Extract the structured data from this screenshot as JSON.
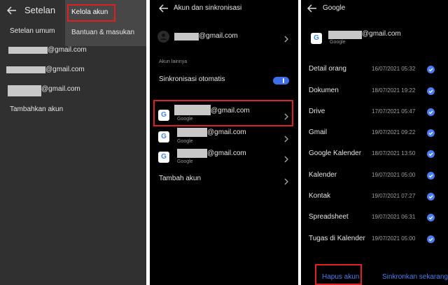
{
  "panel1": {
    "title": "Setelan",
    "menu": [
      "Setelan umum",
      "Tambahkan akun"
    ],
    "accounts": [
      "@gmail.com",
      "@gmail.com",
      "@gmail.com"
    ],
    "popup": {
      "manage": "Kelola akun",
      "help": "Bantuan & masukan"
    }
  },
  "panel2": {
    "title": "Akun dan sinkronisasi",
    "main_account": "@gmail.com",
    "other_label": "Akun lainnya",
    "auto_sync": "Sinkronisasi otomatis",
    "accounts": [
      {
        "email": "@gmail.com",
        "type": "Google"
      },
      {
        "email": "@gmail.com",
        "type": "Google"
      },
      {
        "email": "@gmail.com",
        "type": "Google"
      }
    ],
    "add_account": "Tambah akun"
  },
  "panel3": {
    "title": "Google",
    "email": "@gmail.com",
    "type": "Google",
    "items": [
      {
        "name": "Detail orang",
        "date": "16/07/2021 05:32"
      },
      {
        "name": "Dokumen",
        "date": "18/07/2021 19:22"
      },
      {
        "name": "Drive",
        "date": "17/07/2021 05:47"
      },
      {
        "name": "Gmail",
        "date": "19/07/2021 09:22"
      },
      {
        "name": "Google Kalender",
        "date": "18/07/2021 13:50"
      },
      {
        "name": "Kalender",
        "date": "19/07/2021 05:00"
      },
      {
        "name": "Kontak",
        "date": "19/07/2021 07:27"
      },
      {
        "name": "Spreadsheet",
        "date": "19/07/2021 06:31"
      },
      {
        "name": "Tugas di Kalender",
        "date": "19/07/2021 05:00"
      }
    ],
    "remove": "Hapus akun",
    "sync_now": "Sinkronkan sekarang"
  },
  "colors": {
    "accent": "#4a7bf0",
    "highlight": "#e02020",
    "toggle": "#3d6fe8"
  }
}
